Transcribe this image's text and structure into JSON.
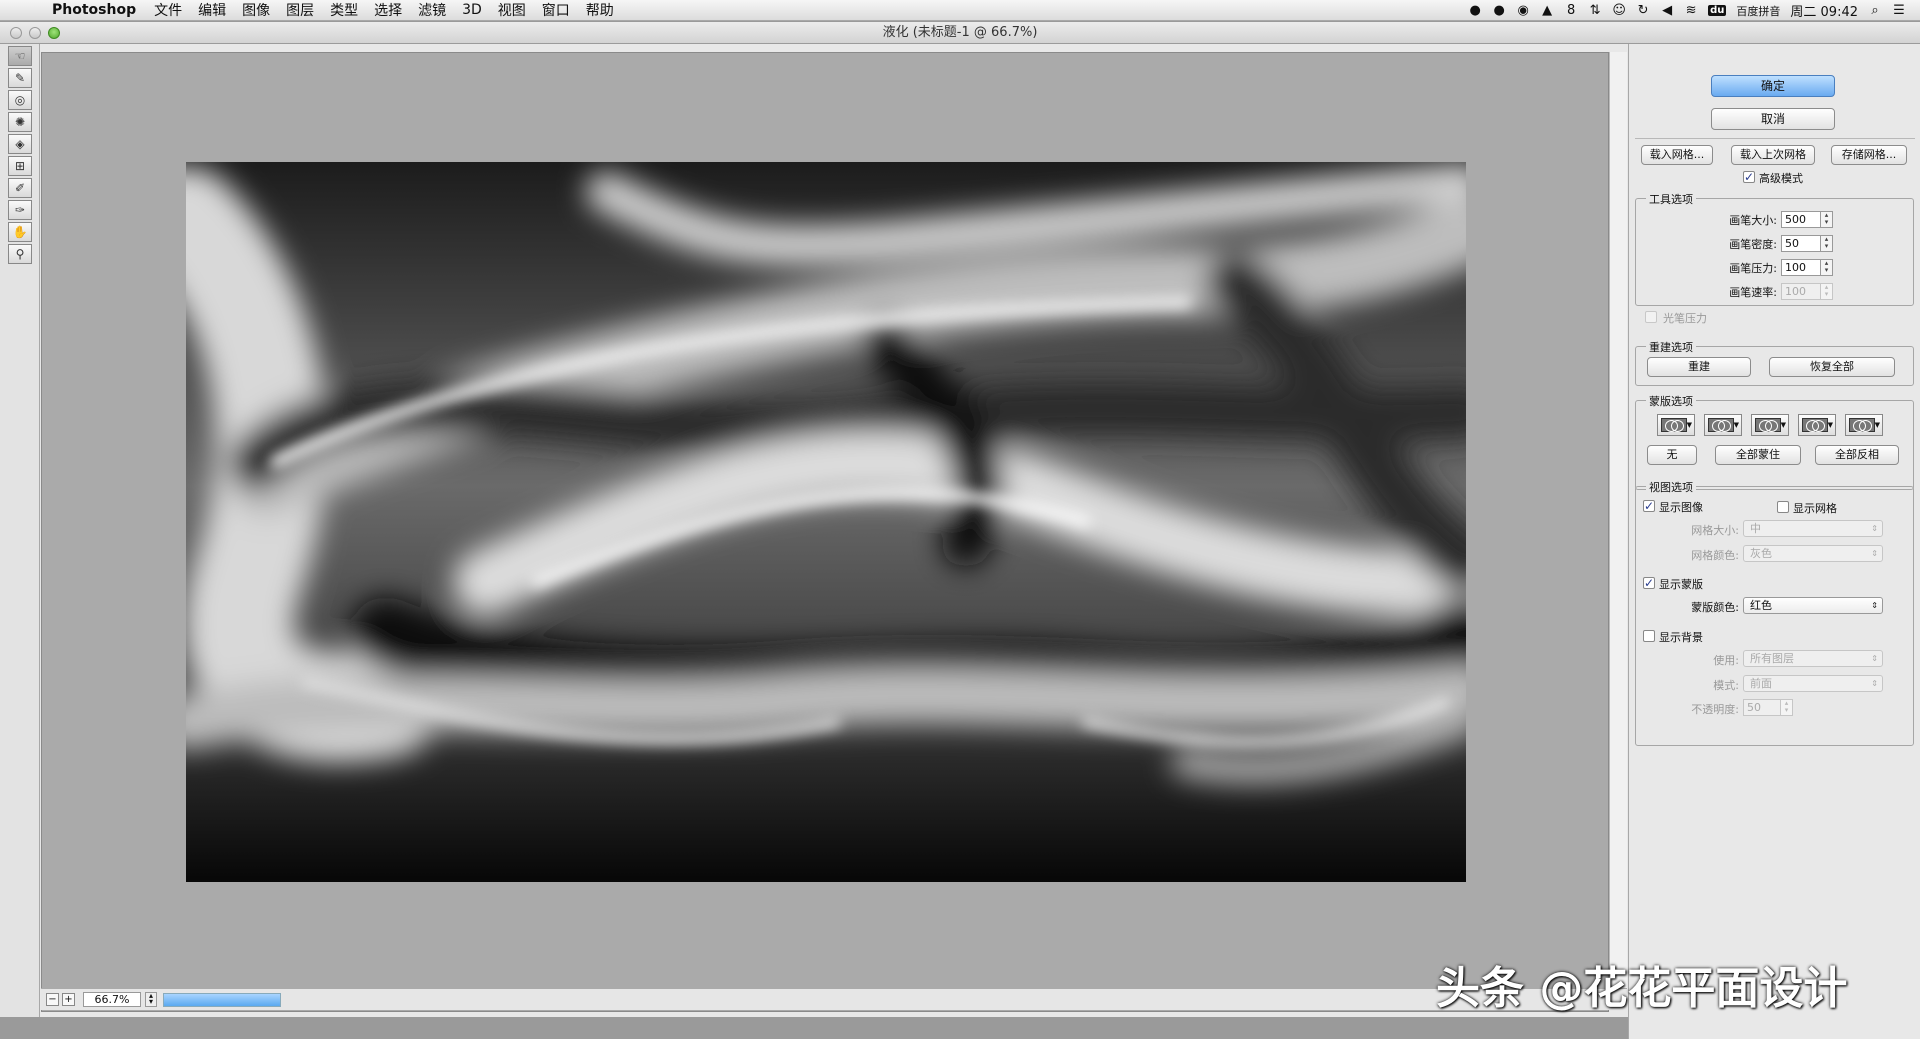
{
  "menubar": {
    "app_name": "Photoshop",
    "items": [
      "文件",
      "编辑",
      "图像",
      "图层",
      "类型",
      "选择",
      "滤镜",
      "3D",
      "视图",
      "窗口",
      "帮助"
    ],
    "status": {
      "badge_count": "8",
      "du_logo": "du",
      "input_method": "百度拼音",
      "clock": "周二 09:42"
    }
  },
  "window": {
    "title": "液化 (未标题-1 @ 66.7%)"
  },
  "tools": [
    "forward-warp",
    "reconstruct",
    "twirl",
    "pucker",
    "bloat",
    "push-left",
    "freeze-mask",
    "thaw-mask",
    "hand",
    "zoom"
  ],
  "canvas": {
    "zoom_value": "66.7%",
    "zoom_out": "−",
    "zoom_in": "+",
    "progress": 1.0
  },
  "panel": {
    "ok": "确定",
    "cancel": "取消",
    "load_mesh": "载入网格...",
    "load_last_mesh": "载入上次网格",
    "save_mesh": "存储网格...",
    "advanced_mode": "高级模式",
    "tool_options": {
      "title": "工具选项",
      "brush_size_label": "画笔大小:",
      "brush_size": "500",
      "brush_density_label": "画笔密度:",
      "brush_density": "50",
      "brush_pressure_label": "画笔压力:",
      "brush_pressure": "100",
      "brush_rate_label": "画笔速率:",
      "brush_rate": "100",
      "stylus_pressure": "光笔压力"
    },
    "reconstruct_options": {
      "title": "重建选项",
      "reconstruct": "重建",
      "restore_all": "恢复全部"
    },
    "mask_options": {
      "title": "蒙版选项",
      "none": "无",
      "mask_all": "全部蒙住",
      "invert_all": "全部反相"
    },
    "view_options": {
      "title": "视图选项",
      "show_image": "显示图像",
      "show_mesh": "显示网格",
      "mesh_size_label": "网格大小:",
      "mesh_size": "中",
      "mesh_color_label": "网格颜色:",
      "mesh_color": "灰色",
      "show_mask": "显示蒙版",
      "mask_color_label": "蒙版颜色:",
      "mask_color": "红色",
      "show_backdrop": "显示背景",
      "use_label": "使用:",
      "use": "所有图层",
      "mode_label": "模式:",
      "mode": "前面",
      "opacity_label": "不透明度:",
      "opacity": "50"
    }
  },
  "watermark": "头条 @花花平面设计",
  "colors": {
    "primary_button": "#6aaaf0",
    "canvas_bg": "#aaaaaa",
    "panel_bg": "#e8e8e8"
  }
}
